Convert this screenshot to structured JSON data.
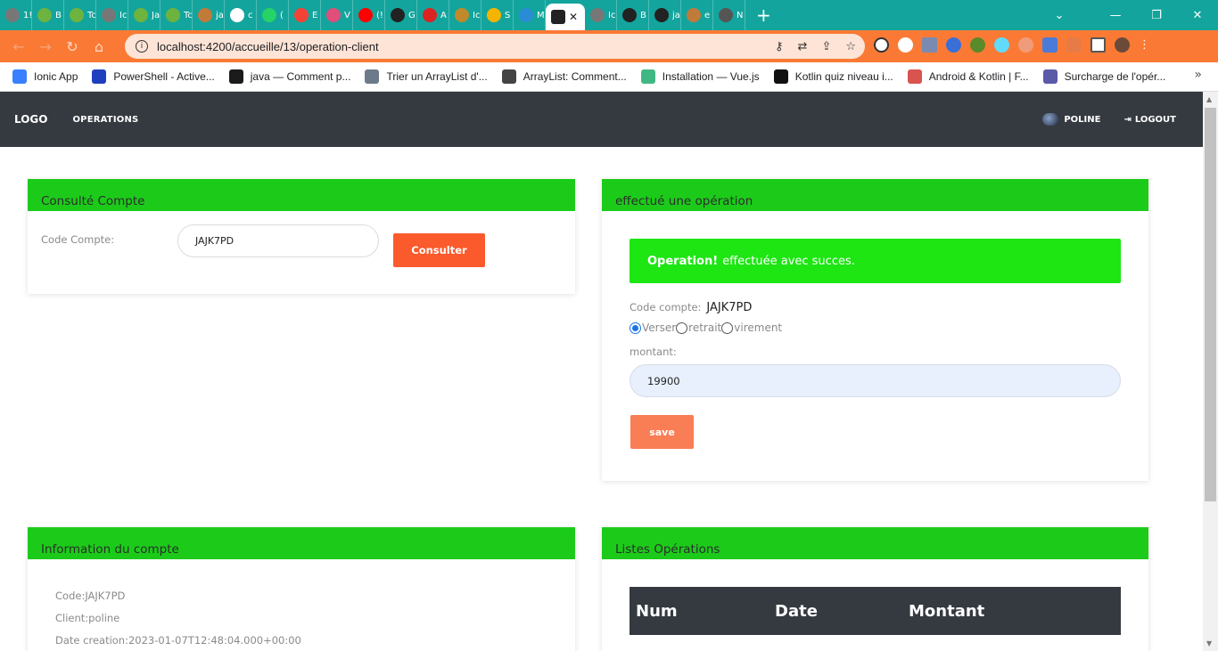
{
  "browser": {
    "tabs": [
      {
        "title": "1!",
        "color": "#777777"
      },
      {
        "title": "B",
        "color": "#6db33f"
      },
      {
        "title": "Tc",
        "color": "#6db33f"
      },
      {
        "title": "Ic",
        "color": "#777777"
      },
      {
        "title": "Ja",
        "color": "#6db33f"
      },
      {
        "title": "Tc",
        "color": "#6db33f"
      },
      {
        "title": "ja",
        "color": "#c07a3a"
      },
      {
        "title": "c",
        "color": "#ffffff"
      },
      {
        "title": "(",
        "color": "#25d366"
      },
      {
        "title": "E",
        "color": "#f44336"
      },
      {
        "title": "V",
        "color": "#e04e7a"
      },
      {
        "title": "(!",
        "color": "#ff0000"
      },
      {
        "title": "G",
        "color": "#222222"
      },
      {
        "title": "A",
        "color": "#dd2222"
      },
      {
        "title": "Ic",
        "color": "#c08a2a"
      },
      {
        "title": "S",
        "color": "#f5b400"
      },
      {
        "title": "M",
        "color": "#2b8cd6"
      },
      {
        "title": "Ic",
        "color": "#777777"
      },
      {
        "title": "B",
        "color": "#222222"
      },
      {
        "title": "ja",
        "color": "#222222"
      },
      {
        "title": "e",
        "color": "#c07a3a"
      },
      {
        "title": "N",
        "color": "#555555"
      }
    ],
    "url": "localhost:4200/accueille/13/operation-client",
    "bookmarks": [
      {
        "label": "Ionic App",
        "color": "#3880ff"
      },
      {
        "label": "PowerShell - Active...",
        "color": "#1f3fbf"
      },
      {
        "label": "java — Comment p...",
        "color": "#1b1b1b"
      },
      {
        "label": "Trier un ArrayList d'...",
        "color": "#6d7a8a"
      },
      {
        "label": "ArrayList: Comment...",
        "color": "#444444"
      },
      {
        "label": "Installation — Vue.js",
        "color": "#41b883"
      },
      {
        "label": "Kotlin quiz niveau i...",
        "color": "#111111"
      },
      {
        "label": "Android & Kotlin | F...",
        "color": "#d9534f"
      },
      {
        "label": "Surcharge de l'opér...",
        "color": "#5a5aa8"
      }
    ]
  },
  "navbar": {
    "logo": "LOGO",
    "operations": "OPERATIONS",
    "user": "POLINE",
    "logout": "LOGOUT"
  },
  "consult": {
    "title": "Consulté Compte",
    "label": "Code Compte:",
    "value": "JAJK7PD",
    "button": "Consulter"
  },
  "operation": {
    "title": "effectué une opération",
    "alert_strong": "Operation!",
    "alert_text": "effectuée avec succes.",
    "code_label": "Code compte:",
    "code_value": "JAJK7PD",
    "radio_options": [
      "Verser",
      "retrait",
      "virement"
    ],
    "selected": "Verser",
    "montant_label": "montant:",
    "montant_value": "19900",
    "save_button": "save"
  },
  "info": {
    "title": "Information du compte",
    "code": "Code:JAJK7PD",
    "client": "Client:poline",
    "date": "Date creation:2023-01-07T12:48:04.000+00:00"
  },
  "list": {
    "title": "Listes Opérations",
    "columns": [
      "Num",
      "Date",
      "Montant"
    ]
  },
  "colors": {
    "card_header": "#1ccb1a",
    "alert": "#1de613",
    "primary_button": "#fa5a2c",
    "navbar": "#343a40"
  }
}
